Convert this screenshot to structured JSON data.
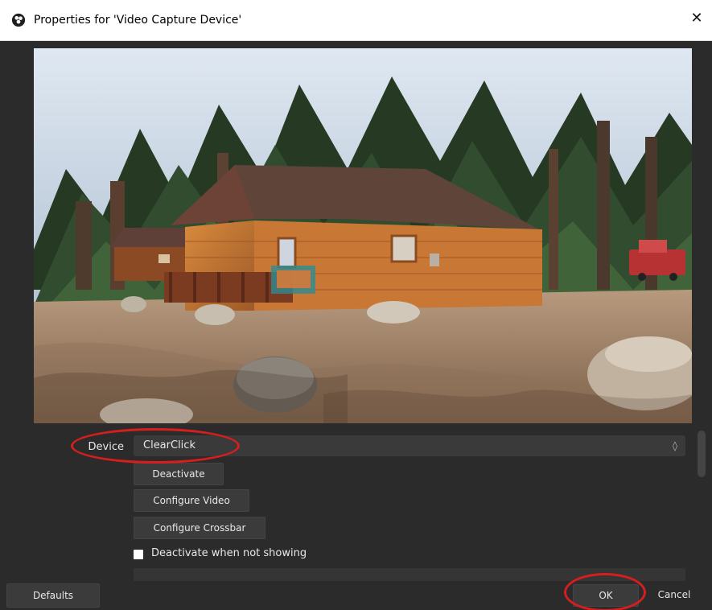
{
  "window": {
    "title": "Properties for 'Video Capture Device'",
    "icon": "obs-logo-icon",
    "close_glyph": "✕"
  },
  "properties": {
    "device_label": "Device",
    "device_value": "ClearClick",
    "dropdown_glyph": "◊",
    "buttons": {
      "deactivate": "Deactivate",
      "configure_video": "Configure Video",
      "configure_crossbar": "Configure Crossbar"
    },
    "checkbox": {
      "label": "Deactivate when not showing",
      "checked": false
    }
  },
  "footer": {
    "defaults": "Defaults",
    "ok": "OK",
    "cancel": "Cancel"
  },
  "colors": {
    "panel_bg": "#2b2b2b",
    "field_bg": "#3a3a3a",
    "highlight": "#d71e1e"
  }
}
